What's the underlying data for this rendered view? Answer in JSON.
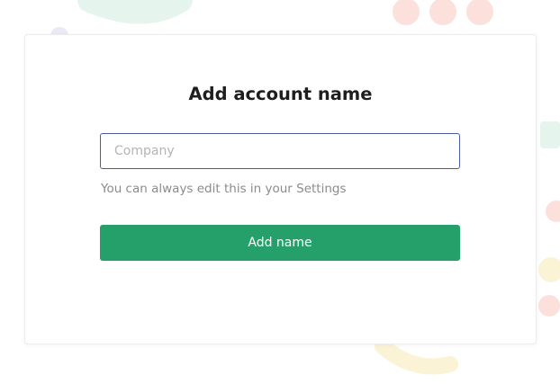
{
  "dialog": {
    "title": "Add account name",
    "company_field": {
      "placeholder": "Company",
      "value": ""
    },
    "hint": "You can always edit this in your Settings",
    "submit_label": "Add name"
  },
  "colors": {
    "accent_green": "#25a06b",
    "input_border": "#4d5aa8",
    "title_text": "#1e1e1e",
    "hint_text": "#8b8b8b",
    "placeholder_text": "#b4b4b4",
    "deco_red": "#fbe0dc",
    "deco_green": "#e6f4ee",
    "deco_yellow": "#fbf3d6"
  }
}
